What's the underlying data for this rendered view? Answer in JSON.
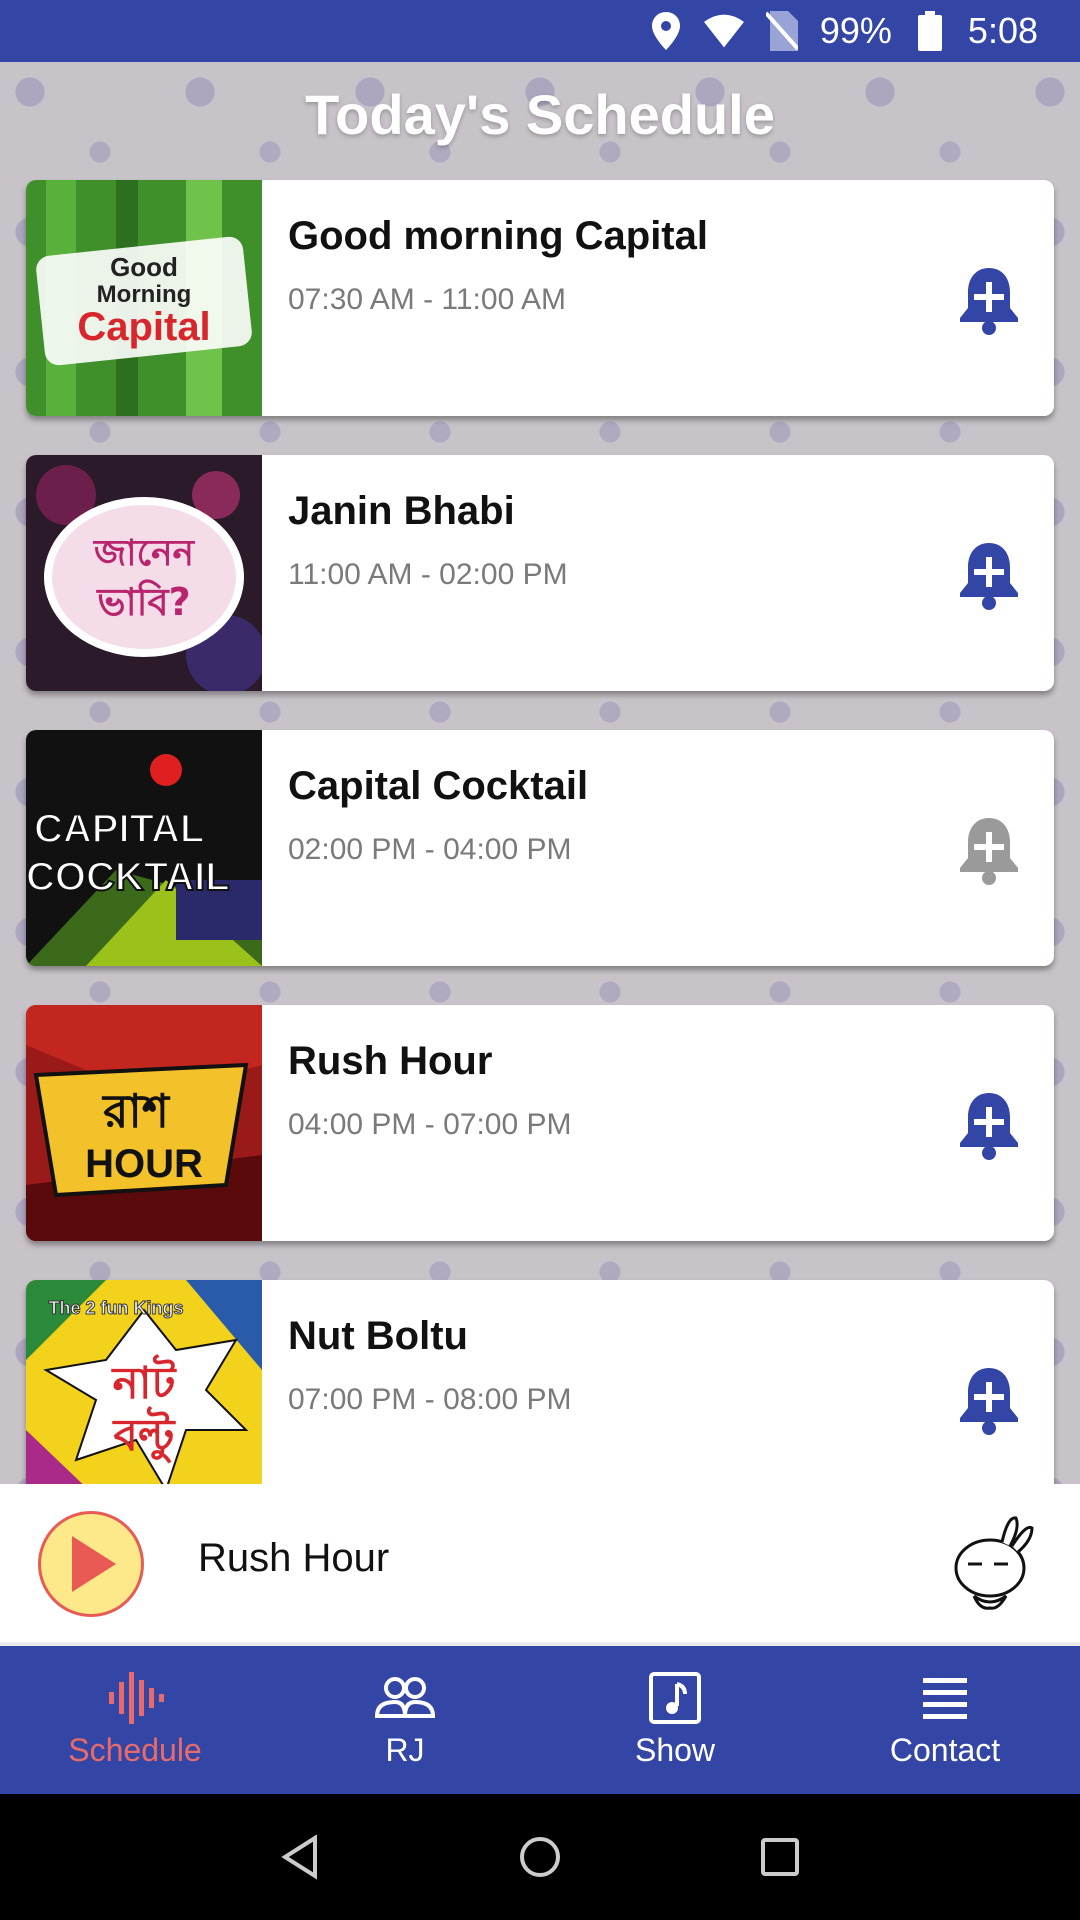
{
  "status_bar": {
    "battery": "99%",
    "time": "5:08",
    "icons": [
      "location-icon",
      "wifi-icon",
      "no-sim-icon",
      "battery-icon"
    ]
  },
  "page": {
    "title": "Today's Schedule"
  },
  "schedule": [
    {
      "name": "Good morning Capital",
      "time": "07:30 AM - 11:00 AM",
      "reminder_active": true,
      "thumb_text": [
        "Good",
        "Morning",
        "Capital"
      ]
    },
    {
      "name": "Janin Bhabi",
      "time": "11:00 AM - 02:00 PM",
      "reminder_active": true,
      "thumb_text": [
        "জানেন",
        "ভাবি?"
      ]
    },
    {
      "name": "Capital Cocktail",
      "time": "02:00 PM - 04:00 PM",
      "reminder_active": false,
      "thumb_text": [
        "CAPITAL",
        "COCKTAIL"
      ]
    },
    {
      "name": "Rush Hour",
      "time": "04:00 PM - 07:00 PM",
      "reminder_active": true,
      "thumb_text": [
        "রাশ",
        "HOUR"
      ]
    },
    {
      "name": "Nut Boltu",
      "time": "07:00 PM - 08:00 PM",
      "reminder_active": true,
      "thumb_text": [
        "The 2 fun Kings",
        "নাট",
        "বল্টু"
      ]
    }
  ],
  "player": {
    "now_playing": "Rush Hour"
  },
  "bottom_nav": [
    {
      "label": "Schedule",
      "icon": "waveform-icon",
      "active": true
    },
    {
      "label": "RJ",
      "icon": "people-icon",
      "active": false
    },
    {
      "label": "Show",
      "icon": "music-note-icon",
      "active": false
    },
    {
      "label": "Contact",
      "icon": "list-icon",
      "active": false
    }
  ],
  "colors": {
    "primary": "#3346a6",
    "accent": "#e86a6a",
    "bell_active": "#3346a6",
    "bell_inactive": "#9a9a9a",
    "play_fill": "#fde98a"
  }
}
